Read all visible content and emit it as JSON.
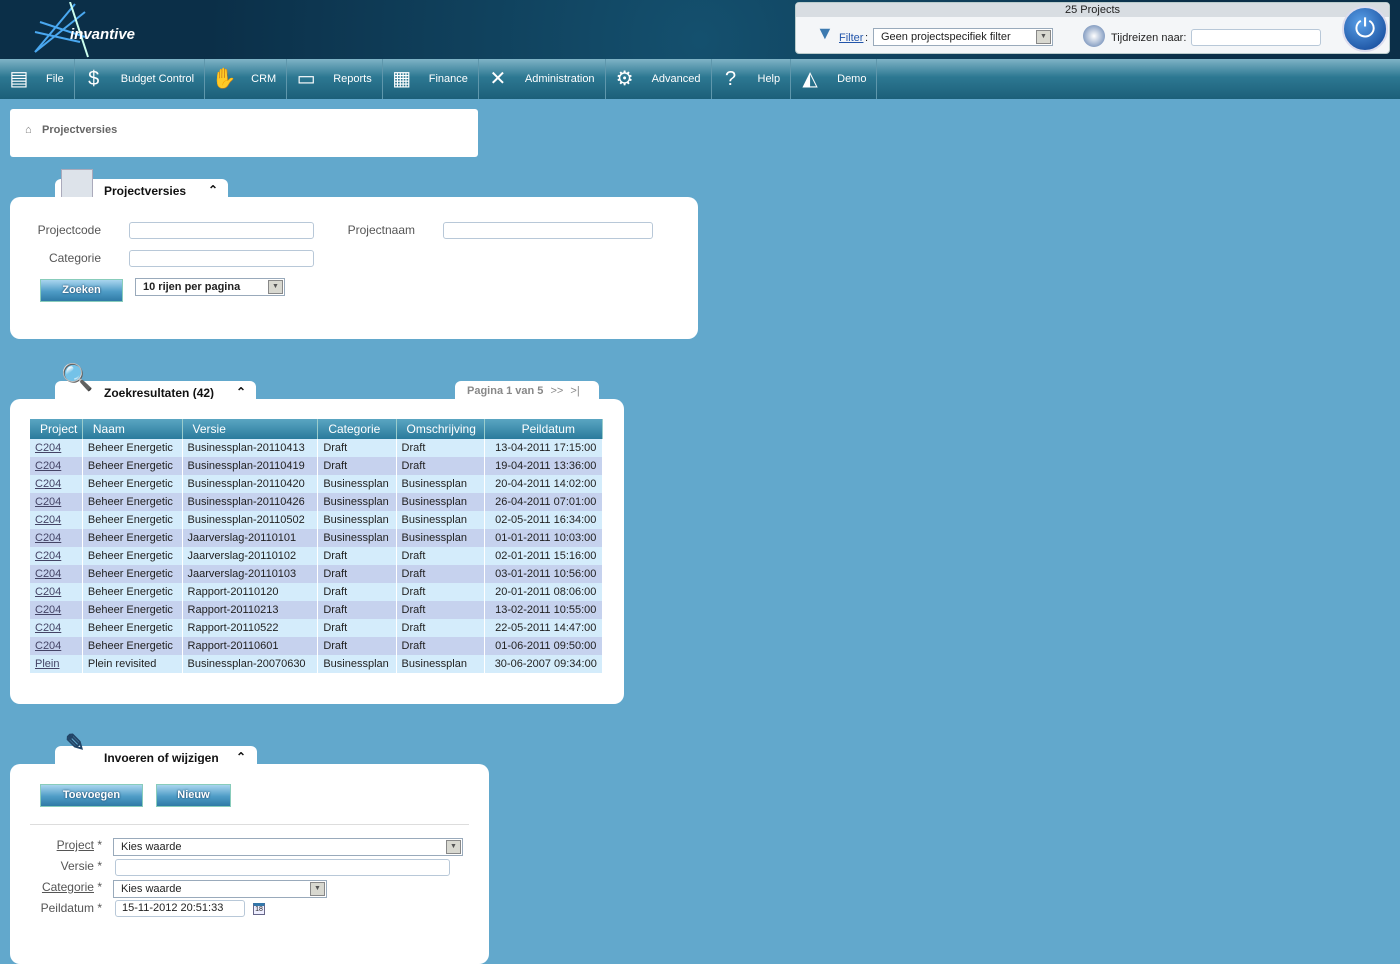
{
  "brand": "invantive",
  "header": {
    "projects_count": "25 Projects",
    "filter_label": "Filter",
    "filter_value": "Geen projectspecifiek filter",
    "timetravel_label": "Tijdreizen naar:",
    "timetravel_value": ""
  },
  "nav": [
    {
      "label": "File",
      "icon": "cabinet-icon"
    },
    {
      "label": "Budget Control",
      "icon": "money-icon"
    },
    {
      "label": "CRM",
      "icon": "handshake-icon"
    },
    {
      "label": "Reports",
      "icon": "presentation-icon"
    },
    {
      "label": "Finance",
      "icon": "calculator-icon"
    },
    {
      "label": "Administration",
      "icon": "tools-icon"
    },
    {
      "label": "Advanced",
      "icon": "gears-icon"
    },
    {
      "label": "Help",
      "icon": "help-icon"
    },
    {
      "label": "Demo",
      "icon": "demo-icon"
    }
  ],
  "breadcrumb": "Projectversies",
  "search": {
    "title": "Projectversies",
    "projectcode_label": "Projectcode",
    "projectnaam_label": "Projectnaam",
    "categorie_label": "Categorie",
    "search_button": "Zoeken",
    "rows_select": "10 rijen per pagina"
  },
  "results": {
    "title": "Zoekresultaten (42)",
    "pagination": "Pagina 1 van 5",
    "next": ">>",
    "last": ">|",
    "columns": [
      "Project",
      "Naam",
      "Versie",
      "Categorie",
      "Omschrijving",
      "Peildatum"
    ],
    "rows": [
      [
        "C204",
        "Beheer Energetic",
        "Businessplan-20110413",
        "Draft",
        "Draft",
        "13-04-2011 17:15:00"
      ],
      [
        "C204",
        "Beheer Energetic",
        "Businessplan-20110419",
        "Draft",
        "Draft",
        "19-04-2011 13:36:00"
      ],
      [
        "C204",
        "Beheer Energetic",
        "Businessplan-20110420",
        "Businessplan",
        "Businessplan",
        "20-04-2011 14:02:00"
      ],
      [
        "C204",
        "Beheer Energetic",
        "Businessplan-20110426",
        "Businessplan",
        "Businessplan",
        "26-04-2011 07:01:00"
      ],
      [
        "C204",
        "Beheer Energetic",
        "Businessplan-20110502",
        "Businessplan",
        "Businessplan",
        "02-05-2011 16:34:00"
      ],
      [
        "C204",
        "Beheer Energetic",
        "Jaarverslag-20110101",
        "Businessplan",
        "Businessplan",
        "01-01-2011 10:03:00"
      ],
      [
        "C204",
        "Beheer Energetic",
        "Jaarverslag-20110102",
        "Draft",
        "Draft",
        "02-01-2011 15:16:00"
      ],
      [
        "C204",
        "Beheer Energetic",
        "Jaarverslag-20110103",
        "Draft",
        "Draft",
        "03-01-2011 10:56:00"
      ],
      [
        "C204",
        "Beheer Energetic",
        "Rapport-20110120",
        "Draft",
        "Draft",
        "20-01-2011 08:06:00"
      ],
      [
        "C204",
        "Beheer Energetic",
        "Rapport-20110213",
        "Draft",
        "Draft",
        "13-02-2011 10:55:00"
      ],
      [
        "C204",
        "Beheer Energetic",
        "Rapport-20110522",
        "Draft",
        "Draft",
        "22-05-2011 14:47:00"
      ],
      [
        "C204",
        "Beheer Energetic",
        "Rapport-20110601",
        "Draft",
        "Draft",
        "01-06-2011 09:50:00"
      ],
      [
        "Plein",
        "Plein revisited",
        "Businessplan-20070630",
        "Businessplan",
        "Businessplan",
        "30-06-2007 09:34:00"
      ]
    ]
  },
  "edit": {
    "title": "Invoeren of wijzigen",
    "add_button": "Toevoegen",
    "new_button": "Nieuw",
    "project_label": "Project",
    "versie_label": "Versie",
    "categorie_label": "Categorie",
    "peildatum_label": "Peildatum",
    "required": "*",
    "project_value": "Kies waarde",
    "categorie_value": "Kies waarde",
    "peildatum_value": "15-11-2012 20:51:33",
    "versie_value": ""
  }
}
